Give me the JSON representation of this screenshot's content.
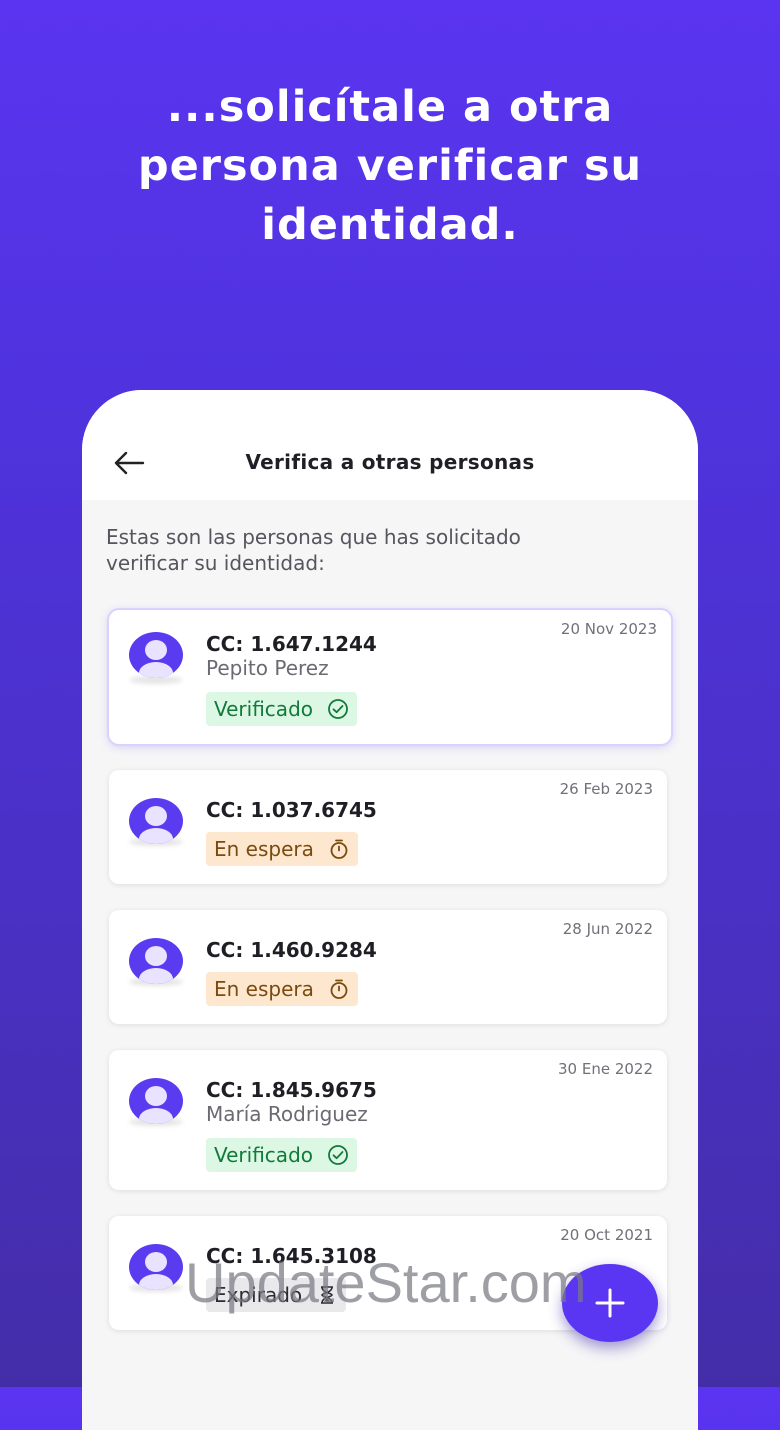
{
  "headline": {
    "line1": "...solicítale a otra",
    "line2": "persona verificar su",
    "line3": "identidad."
  },
  "screen": {
    "title": "Verifica a otras personas",
    "intro_line1": "Estas son las personas que has solicitado",
    "intro_line2": "verificar su identidad:",
    "back_icon": "arrow-left-icon",
    "fab_icon": "plus-icon"
  },
  "requests": [
    {
      "date": "20 Nov 2023",
      "cc": "CC: 1.647.1244",
      "name": "Pepito Perez",
      "status": "Verificado",
      "status_icon": "check-circle-icon"
    },
    {
      "date": "26 Feb 2023",
      "cc": "CC: 1.037.6745",
      "name": "",
      "status": "En espera",
      "status_icon": "stopwatch-icon"
    },
    {
      "date": "28 Jun 2022",
      "cc": "CC: 1.460.9284",
      "name": "",
      "status": "En espera",
      "status_icon": "stopwatch-icon"
    },
    {
      "date": "30 Ene 2022",
      "cc": "CC: 1.845.9675",
      "name": "María Rodriguez",
      "status": "Verificado",
      "status_icon": "check-circle-icon"
    },
    {
      "date": "20 Oct 2021",
      "cc": "CC: 1.645.3108",
      "name": "",
      "status": "Expirado",
      "status_icon": "hourglass-icon"
    }
  ],
  "colors": {
    "accent": "#5a36f2",
    "verified_bg": "#dcf8e4",
    "verified_text": "#117a3a",
    "waiting_bg": "#fde8cf",
    "waiting_text": "#7a4b10",
    "expired_bg": "#e9e9ec"
  },
  "watermark": "UpdateStar.com"
}
